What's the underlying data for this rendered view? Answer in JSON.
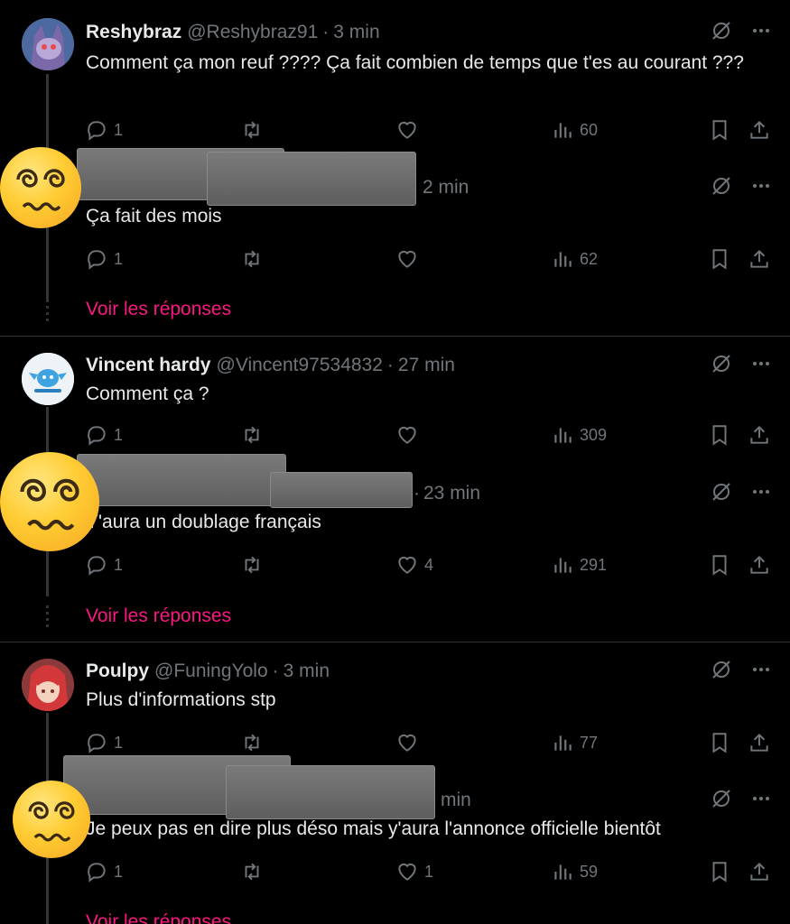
{
  "threads": [
    {
      "parent": {
        "name": "Reshybraz",
        "handle": "@Reshybraz91",
        "sep": "·",
        "time": "3 min",
        "text": "Comment ça mon reuf ???? Ça fait combien de temps que t'es au courant ???",
        "stats": {
          "replies": "1",
          "retweets": "",
          "likes": "",
          "views": "60"
        }
      },
      "reply": {
        "time": "2 min",
        "text": "Ça fait des mois",
        "stats": {
          "replies": "1",
          "retweets": "",
          "likes": "",
          "views": "62"
        }
      },
      "more": "Voir les réponses"
    },
    {
      "parent": {
        "name": "Vincent hardy",
        "handle": "@Vincent97534832",
        "sep": "·",
        "time": "27 min",
        "text": "Comment ça ?",
        "stats": {
          "replies": "1",
          "retweets": "",
          "likes": "",
          "views": "309"
        }
      },
      "reply": {
        "time": "23 min",
        "text": "Y'aura un doublage français",
        "stats": {
          "replies": "1",
          "retweets": "",
          "likes": "4",
          "views": "291"
        }
      },
      "more": "Voir les réponses"
    },
    {
      "parent": {
        "name": "Poulpy",
        "handle": "@FuningYolo",
        "sep": "·",
        "time": "3 min",
        "text": "Plus d'informations stp",
        "stats": {
          "replies": "1",
          "retweets": "",
          "likes": "",
          "views": "77"
        }
      },
      "reply": {
        "time": "min",
        "text": "Je peux pas en dire plus déso mais y'aura l'annonce officielle bientôt",
        "stats": {
          "replies": "1",
          "retweets": "",
          "likes": "1",
          "views": "59"
        }
      },
      "more": "Voir les réponses"
    }
  ],
  "colors": {
    "background": "#000000",
    "text": "#e7e9ea",
    "muted": "#71767b",
    "link": "#f91880",
    "divider": "#2f3336"
  },
  "icons": [
    "grok-icon",
    "more-icon",
    "reply-icon",
    "retweet-icon",
    "like-icon",
    "views-icon",
    "bookmark-icon",
    "share-icon",
    "dizzy-face-emoji"
  ]
}
